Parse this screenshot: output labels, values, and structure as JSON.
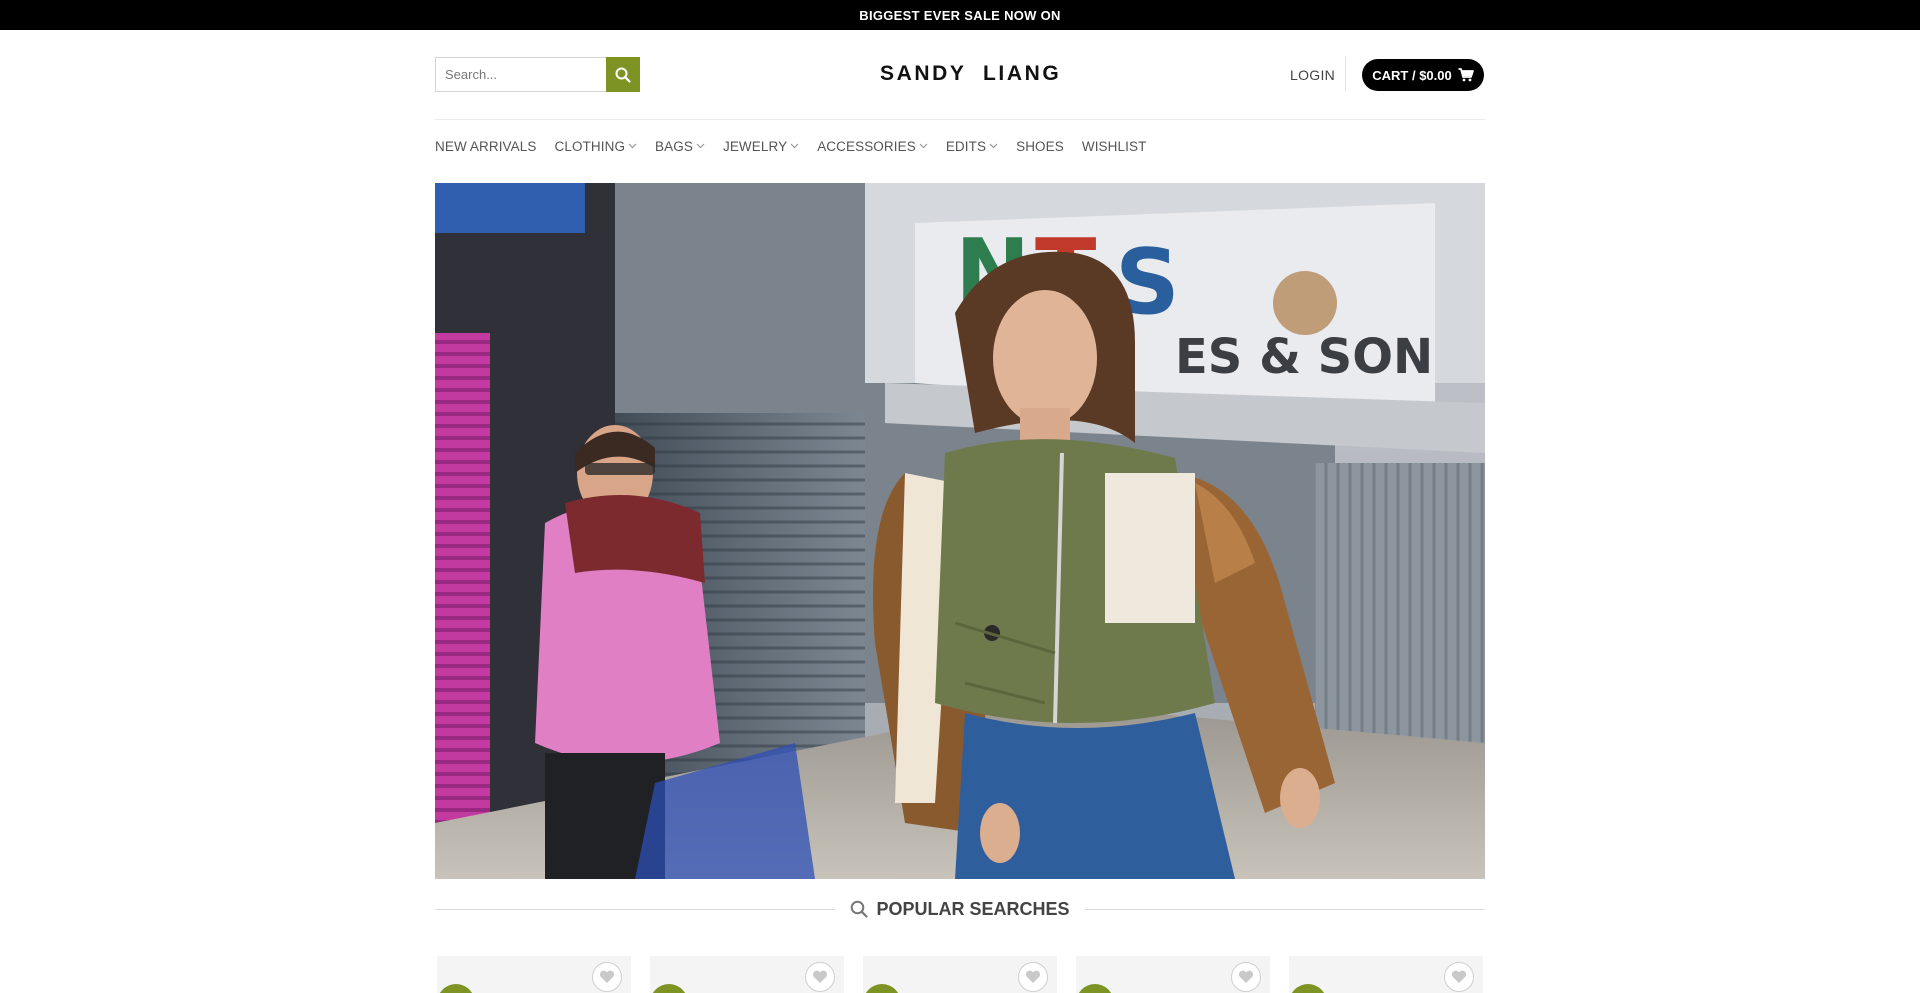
{
  "topbar": {
    "text": "BIGGEST EVER SALE NOW ON"
  },
  "header": {
    "search_placeholder": "Search...",
    "logo": "SANDY  LIANG",
    "login": "LOGIN",
    "cart": "CART / $0.00"
  },
  "nav": [
    {
      "label": "NEW ARRIVALS",
      "dropdown": false
    },
    {
      "label": "CLOTHING",
      "dropdown": true
    },
    {
      "label": "BAGS",
      "dropdown": true
    },
    {
      "label": "JEWELRY",
      "dropdown": true
    },
    {
      "label": "ACCESSORIES",
      "dropdown": true
    },
    {
      "label": "EDITS",
      "dropdown": true
    },
    {
      "label": "SHOES",
      "dropdown": false
    },
    {
      "label": "WISHLIST",
      "dropdown": false
    }
  ],
  "popular": {
    "title": "POPULAR SEARCHES"
  },
  "colors": {
    "accent": "#7d9425",
    "topbar": "#000000"
  },
  "icons": {
    "search": "search-icon",
    "cart": "cart-icon",
    "wishlist": "heart-icon",
    "chevron": "chevron-down-icon"
  }
}
